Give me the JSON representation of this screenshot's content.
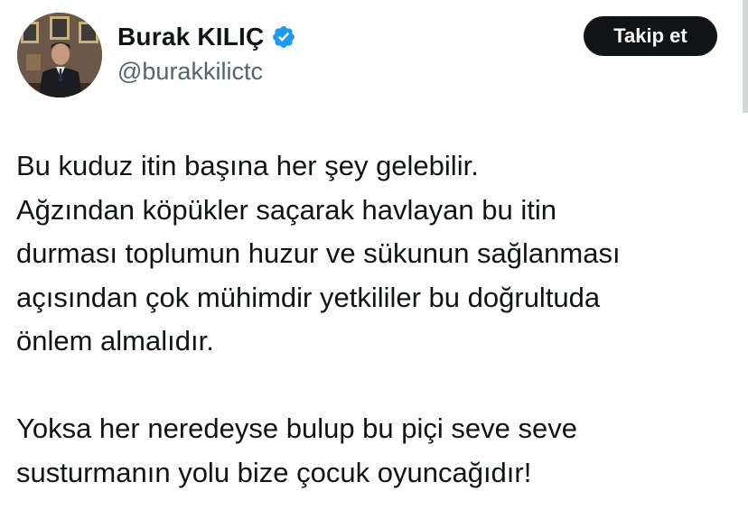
{
  "user": {
    "name": "Burak KILIÇ",
    "handle": "@burakkilictc",
    "verified_color": "#1d9bf0",
    "follow_label": "Takip et"
  },
  "tweet": {
    "paragraph1": [
      "Bu kuduz itin başına her şey gelebilir.",
      "Ağzından köpükler saçarak havlayan bu itin",
      "durması toplumun huzur ve sükunun sağlanması",
      "açısından çok mühimdir yetkililer bu doğrultuda",
      "önlem almalıdır."
    ],
    "paragraph2": [
      "Yoksa her neredeyse bulup bu piçi seve seve",
      "susturmanın yolu bize çocuk oyuncağıdır!"
    ]
  }
}
